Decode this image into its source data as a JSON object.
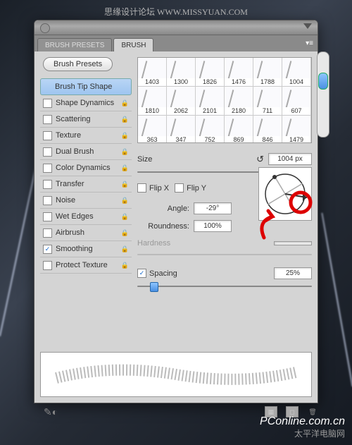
{
  "header_text": "思缘设计论坛 WWW.MISSYUAN.COM",
  "tabs": {
    "presets": "BRUSH PRESETS",
    "brush": "BRUSH"
  },
  "presets_button": "Brush Presets",
  "options": [
    {
      "label": "Brush Tip Shape",
      "checked": null,
      "selected": true
    },
    {
      "label": "Shape Dynamics",
      "checked": false
    },
    {
      "label": "Scattering",
      "checked": false
    },
    {
      "label": "Texture",
      "checked": false
    },
    {
      "label": "Dual Brush",
      "checked": false
    },
    {
      "label": "Color Dynamics",
      "checked": false
    },
    {
      "label": "Transfer",
      "checked": false
    },
    {
      "label": "Noise",
      "checked": false
    },
    {
      "label": "Wet Edges",
      "checked": false
    },
    {
      "label": "Airbrush",
      "checked": false
    },
    {
      "label": "Smoothing",
      "checked": true
    },
    {
      "label": "Protect Texture",
      "checked": false
    }
  ],
  "brushes": [
    [
      "1403",
      "1300",
      "1826",
      "1476",
      "1788",
      "1004"
    ],
    [
      "1810",
      "2062",
      "2101",
      "2180",
      "711",
      "607"
    ],
    [
      "363",
      "347",
      "752",
      "869",
      "846",
      "1479"
    ]
  ],
  "size": {
    "label": "Size",
    "value": "1004 px"
  },
  "flip": {
    "x": "Flip X",
    "y": "Flip Y"
  },
  "angle": {
    "label": "Angle:",
    "value": "-29°"
  },
  "roundness": {
    "label": "Roundness:",
    "value": "100%"
  },
  "hardness": {
    "label": "Hardness"
  },
  "spacing": {
    "label": "Spacing",
    "value": "25%",
    "checked": true
  },
  "footer": {
    "brand": "PConline.com.cn",
    "sub": "太平洋电脑网"
  }
}
